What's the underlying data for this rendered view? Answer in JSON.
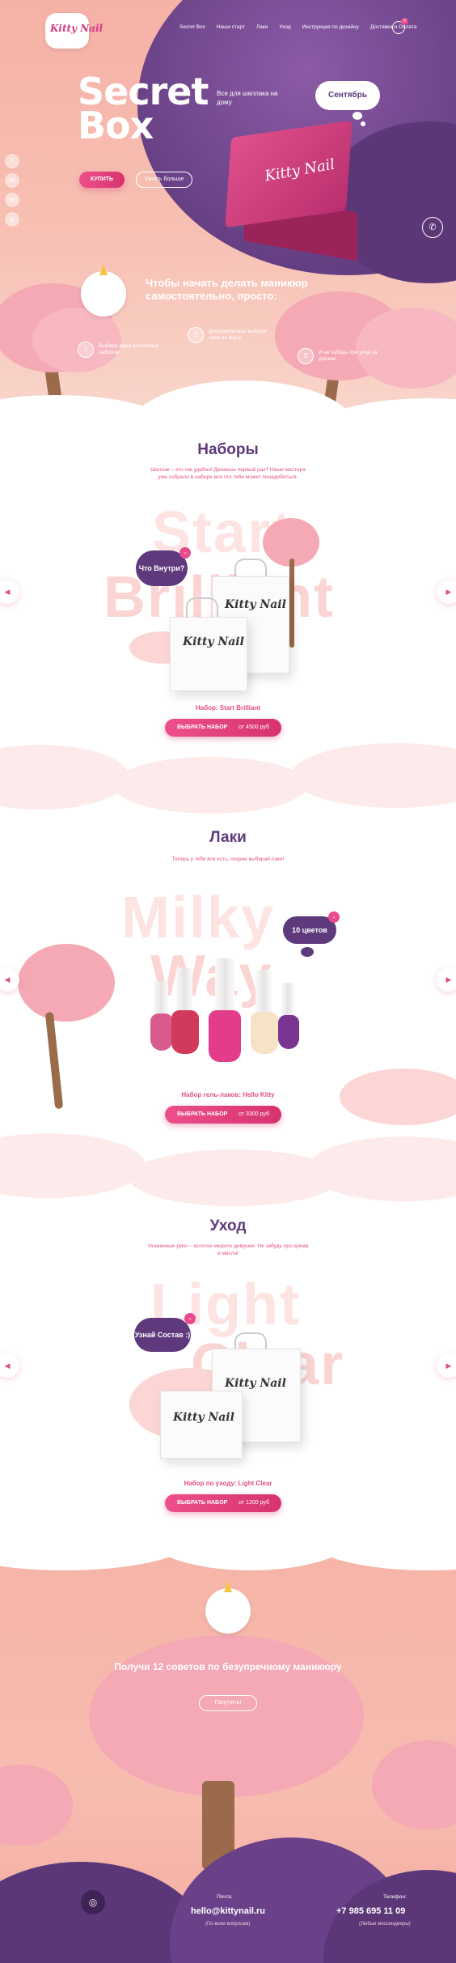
{
  "brand": {
    "logo_text": "Kitty Nail",
    "box_logo": "Kitty Nail"
  },
  "nav": {
    "items": [
      "Secret Box",
      "Наши старт",
      "Лаки",
      "Уход",
      "Инструкция по дизайну",
      "Доставка и Оплата"
    ],
    "cart_count": "0"
  },
  "hero": {
    "title_line1": "Secret",
    "title_line2": "Box",
    "subtitle": "Все для шеллака на дому",
    "month": "Сентябрь",
    "buy_label": "КУПИТЬ",
    "more_label": "Узнать больше"
  },
  "socials": [
    "f",
    "vk",
    "tw",
    "ig"
  ],
  "steps": {
    "title": "Чтобы начать делать маникюр самостоятельно, просто:",
    "items": [
      {
        "num": "1",
        "text": "Выбери один из готовых наборов"
      },
      {
        "num": "2",
        "text": "Дополнительно выбери лаки по вкусу"
      },
      {
        "num": "3",
        "text": "И не забудь про уход за руками"
      }
    ]
  },
  "sets": {
    "title": "Наборы",
    "desc": "Шеллак – это так удобно! Делаешь первый раз? Наши мастера уже собрали в наборе все что тебе может понадобиться.",
    "big_word_1": "Start",
    "big_word_2": "Brilliant",
    "bubble": "Что Внутри?",
    "caption": "Набор: Start Brilliant",
    "button": "ВЫБРАТЬ НАБОР",
    "price": "от 4500 руб"
  },
  "lacquers": {
    "title": "Лаки",
    "desc": "Теперь у тебя все есть, скорее выбирай лаки!",
    "big_word_1": "Milky",
    "big_word_2": "Way",
    "bubble": "10 цветов",
    "caption": "Набор гель-лаков: Hello Kitty",
    "button": "ВЫБРАТЬ НАБОР",
    "price": "от 3300 руб"
  },
  "care": {
    "title": "Уход",
    "desc": "Ухоженные руки – золотое мерило девушки. Не забудь про крема и масла!",
    "big_word_1": "Light",
    "big_word_2": "Clear",
    "bubble": "Узнай Состав :)",
    "caption": "Набор по уходу: Light Clear",
    "button": "ВЫБРАТЬ НАБОР",
    "price": "от 1200 руб"
  },
  "promo": {
    "title": "Получи 12 советов по безупречному маникюру",
    "button": "Получить!"
  },
  "footer": {
    "mail_label": "Почта:",
    "mail": "hello@kittynail.ru",
    "mail_note": "(По всем вопросам)",
    "phone_label": "Телефон:",
    "phone": "+7 985 695 11 09",
    "phone_note": "(Любые мессенджеры)"
  },
  "colors": {
    "pink": "#e84a8d",
    "purple": "#5e3a7c",
    "peach": "#f6b1a6"
  }
}
